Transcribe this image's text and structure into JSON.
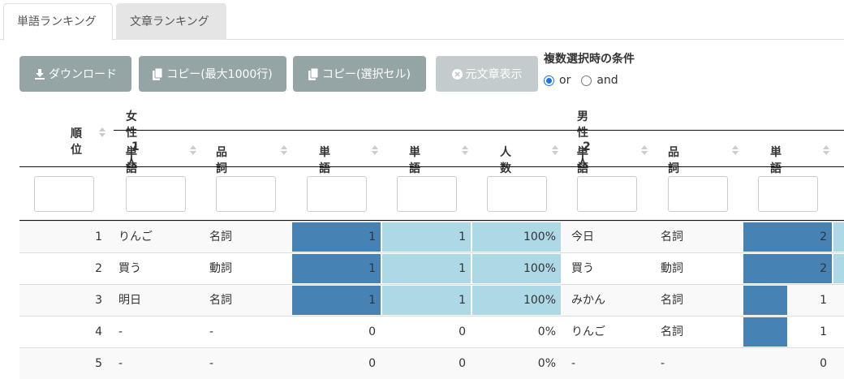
{
  "tabs": [
    {
      "label": "単語ランキング",
      "active": true
    },
    {
      "label": "文章ランキング",
      "active": false
    }
  ],
  "buttons": {
    "download": "ダウンロード",
    "copy_max": "コピー(最大1000行)",
    "copy_sel": "コピー(選択セル)",
    "show_original": "元文章表示"
  },
  "condition": {
    "title": "複数選択時の条件",
    "options": [
      "or",
      "and"
    ],
    "selected": "or"
  },
  "table": {
    "rank_header": "順位",
    "group1": "女性_1人",
    "group2": "男性_2人",
    "columns": {
      "word": "単語",
      "pos": "品詞",
      "freq": "単語頻度",
      "people": "単語人数",
      "ratio": "人数割合"
    },
    "rows": [
      {
        "rank": "1",
        "g1_word": "りんご",
        "g1_pos": "名詞",
        "g1_freq": "1",
        "g1_people": "1",
        "g1_ratio": "100%",
        "g2_word": "今日",
        "g2_pos": "名詞",
        "g2_freq": "2"
      },
      {
        "rank": "2",
        "g1_word": "買う",
        "g1_pos": "動詞",
        "g1_freq": "1",
        "g1_people": "1",
        "g1_ratio": "100%",
        "g2_word": "買う",
        "g2_pos": "動詞",
        "g2_freq": "2"
      },
      {
        "rank": "3",
        "g1_word": "明日",
        "g1_pos": "名詞",
        "g1_freq": "1",
        "g1_people": "1",
        "g1_ratio": "100%",
        "g2_word": "みかん",
        "g2_pos": "名詞",
        "g2_freq": "1"
      },
      {
        "rank": "4",
        "g1_word": "-",
        "g1_pos": "-",
        "g1_freq": "0",
        "g1_people": "0",
        "g1_ratio": "0%",
        "g2_word": "りんご",
        "g2_pos": "名詞",
        "g2_freq": "1"
      },
      {
        "rank": "5",
        "g1_word": "-",
        "g1_pos": "-",
        "g1_freq": "0",
        "g1_people": "0",
        "g1_ratio": "0%",
        "g2_word": "-",
        "g2_pos": "-",
        "g2_freq": "0"
      }
    ],
    "bar_levels": {
      "g1_freq_max": 1,
      "g1_people_max": 1,
      "g2_freq_max": 2
    }
  },
  "colors": {
    "bar_dark": "#4682b4",
    "bar_light": "#add8e6",
    "button": "#95a5a6"
  }
}
